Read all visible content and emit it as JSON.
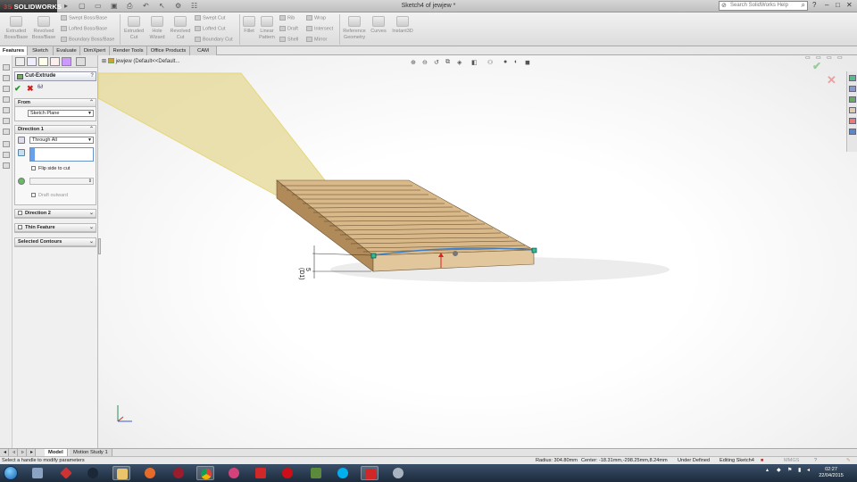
{
  "app": {
    "logo_prefix": "3S",
    "logo_text": "SOLIDWORKS",
    "window_title": "Sketch4 of jewjew *",
    "search_placeholder": "Search SolidWorks Help",
    "help_icon": "?",
    "min": "–",
    "max": "□",
    "close": "✕"
  },
  "ribbon": {
    "buttons": [
      {
        "label1": "Extruded",
        "label2": "Boss/Base"
      },
      {
        "label1": "Revolved",
        "label2": "Boss/Base"
      },
      {
        "label1": "Extruded",
        "label2": "Cut"
      },
      {
        "label1": "Hole",
        "label2": "Wizard"
      },
      {
        "label1": "Revolved",
        "label2": "Cut"
      },
      {
        "label1": "Fillet",
        "label2": ""
      },
      {
        "label1": "Linear",
        "label2": "Pattern"
      },
      {
        "label1": "Reference",
        "label2": "Geometry"
      },
      {
        "label1": "Curves",
        "label2": ""
      },
      {
        "label1": "Instant3D",
        "label2": ""
      }
    ],
    "small_left": [
      "Swept Boss/Base",
      "Lofted Boss/Base",
      "Boundary Boss/Base"
    ],
    "small_cut": [
      "Swept Cut",
      "Lofted Cut",
      "Boundary Cut"
    ],
    "small_mid": [
      "Rib",
      "Draft",
      "Shell"
    ],
    "small_right": [
      "Wrap",
      "Intersect",
      "Mirror"
    ]
  },
  "tabs": [
    "Features",
    "Sketch",
    "Evaluate",
    "DimXpert",
    "Render Tools",
    "Office Products",
    "CAM"
  ],
  "tree": {
    "label": "jewjew (Default<<Default..."
  },
  "property_manager": {
    "title": "Cut-Extrude",
    "help": "?",
    "ok": "✔",
    "cancel": "✖",
    "detail": "6∂",
    "from": {
      "label": "From",
      "value": "Sketch Plane"
    },
    "direction1": {
      "label": "Direction 1",
      "end_condition": "Through All",
      "flip_side": "Flip side to cut",
      "draft_outward": "Draft outward"
    },
    "direction2": {
      "label": "Direction 2"
    },
    "thin_feature": {
      "label": "Thin Feature"
    },
    "selected_contours": {
      "label": "Selected Contours"
    },
    "collapse": "⌃",
    "expand": "⌄"
  },
  "viewport": {
    "dimension_label": "5",
    "dimension_label2": "(D1)",
    "wood_color": "#d9b98a",
    "plane_color": "#e6dca0"
  },
  "bottom_tabs": [
    "Model",
    "Motion Study 1"
  ],
  "status": {
    "hint": "Select a handle to modify parameters",
    "radius": "Radius: 304.80mm",
    "center": "Center: -18.31mm,-298.25mm,8.24mm",
    "defined": "Under Defined",
    "editing": "Editing Sketch4",
    "units": "MMGS"
  },
  "clock": {
    "time": "02:27",
    "date": "22/04/2015"
  }
}
